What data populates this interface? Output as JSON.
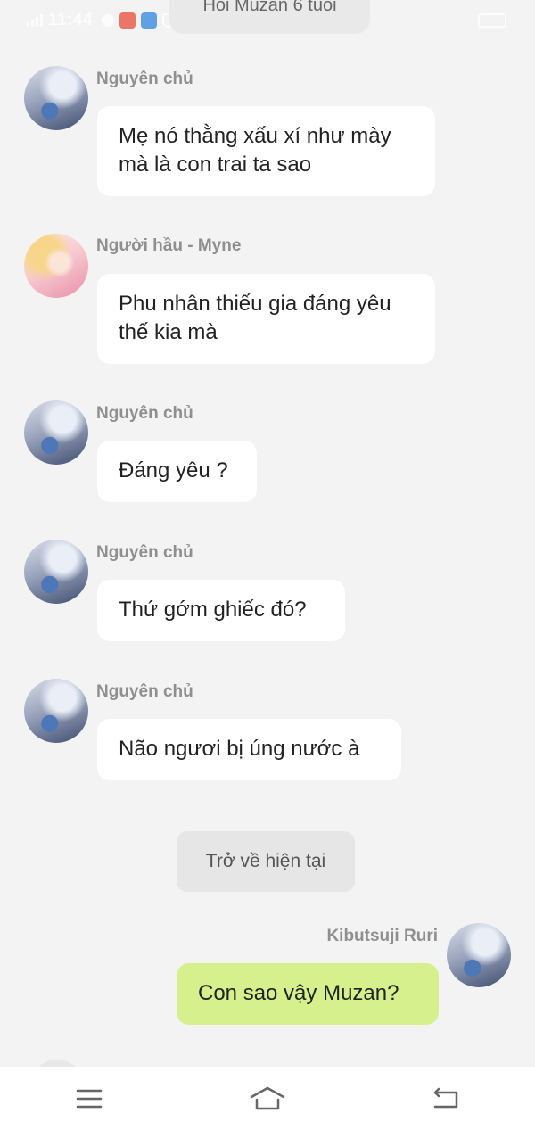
{
  "status_bar": {
    "time": "11:44"
  },
  "header": {
    "title": "Hồi Muzan 6 tuổi"
  },
  "messages": [
    {
      "sender": "Nguyên chủ",
      "text": "Mẹ nó thằng xấu xí như mày mà là con trai ta sao"
    },
    {
      "sender": "Người hầu - Myne",
      "text": "Phu nhân thiếu gia đáng yêu thế kia mà"
    },
    {
      "sender": "Nguyên chủ",
      "text": "Đáng yêu ?"
    },
    {
      "sender": "Nguyên chủ",
      "text": "Thứ gớm ghiếc đó?"
    },
    {
      "sender": "Nguyên chủ",
      "text": "Não ngươi bị úng nước à"
    },
    {
      "sender": "Kibutsuji Ruri",
      "text": "Con sao vậy Muzan?"
    }
  ],
  "return_button": {
    "label": "Trở về hiện tại"
  },
  "colors": {
    "background": "#f3f3f3",
    "bubble": "#ffffff",
    "own_bubble": "#d5f08c",
    "sender": "#8f8f8f"
  },
  "icons": {
    "nav": [
      "menu-icon",
      "home-icon",
      "back-icon"
    ]
  }
}
